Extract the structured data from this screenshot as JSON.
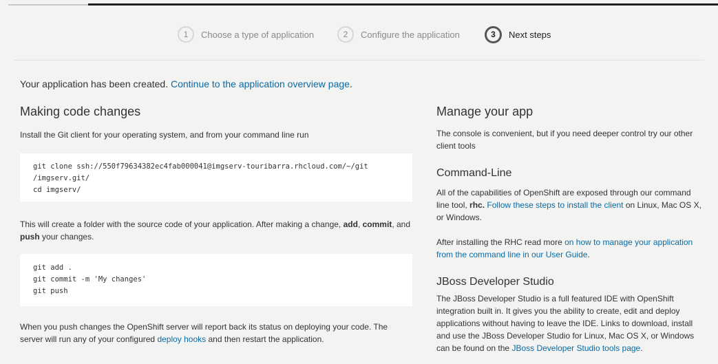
{
  "wizard": {
    "steps": [
      {
        "number": "1",
        "label": "Choose a type of application"
      },
      {
        "number": "2",
        "label": "Configure the application"
      },
      {
        "number": "3",
        "label": "Next steps"
      }
    ]
  },
  "status": {
    "created_text": "Your application has been created.",
    "overview_link": "Continue to the application overview page",
    "period": "."
  },
  "code_changes": {
    "heading": "Making code changes",
    "intro": "Install the Git client for your operating system, and from your command line run",
    "clone_lines": [
      "git clone ssh://550f79634382ec4fab000041@imgserv-touribarra.rhcloud.com/~/git",
      "/imgserv.git/",
      "cd imgserv/"
    ],
    "folder_text_1": "This will create a folder with the source code of your application. After making a change,",
    "add": "add",
    "comma_1": ",",
    "commit": "commit",
    "and_text": ", and",
    "push": "push",
    "folder_text_2": "your changes.",
    "push_lines": [
      "git add .",
      "git commit -m 'My changes'",
      "git push"
    ],
    "server_text_1": "When you push changes the OpenShift server will report back its status on deploying your code.",
    "server_text_2": "The server will run any of your configured",
    "deploy_hooks_link": "deploy hooks",
    "server_text_3": "and then restart the application."
  },
  "manage": {
    "heading": "Manage your app",
    "intro": "The console is convenient, but if you need deeper control try our other client tools",
    "cli_heading": "Command-Line",
    "cli_text_1": "All of the capabilities of OpenShift are exposed through our command line tool,",
    "rhc": "rhc.",
    "cli_link": "Follow these steps to install the client",
    "cli_text_2": "on Linux, Mac OS X, or Windows.",
    "rhc_text": "After installing the RHC read more",
    "rhc_link": "on how to manage your application from the command line in our User Guide",
    "rhc_period": ".",
    "jboss_heading": "JBoss Developer Studio",
    "jboss_text": "The JBoss Developer Studio is a full featured IDE with OpenShift integration built in. It gives you the ability to create, edit and deploy applications without having to leave the IDE. Links to download, install and use the JBoss Developer Studio for Linux, Mac OS X, or Windows can be found on the",
    "jboss_link": "JBoss Developer Studio tools page",
    "jboss_period": "."
  }
}
